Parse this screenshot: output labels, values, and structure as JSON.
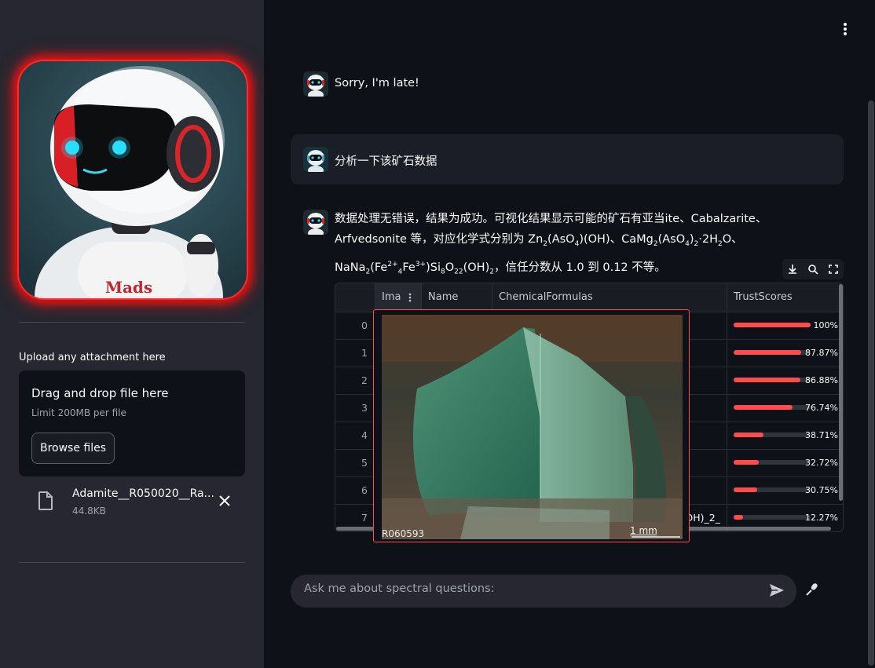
{
  "sidebar": {
    "avatar_brand": "Mads",
    "upload_label": "Upload any attachment here",
    "dropzone": {
      "title": "Drag and drop file here",
      "limit": "Limit 200MB per file",
      "browse_label": "Browse files"
    },
    "file": {
      "name": "Adamite__R050020__Ra...",
      "size": "44.8KB"
    }
  },
  "chat": {
    "messages": [
      {
        "role": "assistant",
        "text": "Sorry, I'm late!"
      },
      {
        "role": "user",
        "text": "分析一下该矿石数据"
      }
    ],
    "result": {
      "line1": "数据处理无错误，结果为成功。可视化结果显示可能的矿石有亚当ite、Cabalzarite、",
      "line2_a": "Arfvedsonite 等，对应化学式分别为 Zn",
      "line2_sub1": "2",
      "line2_b": "(AsO",
      "line2_sub2": "4",
      "line2_c": ")(OH)、CaMg",
      "line2_sub3": "2",
      "line2_d": "(AsO",
      "line2_sub4": "4",
      "line2_e": ")",
      "line2_sub5": "2",
      "line2_f": "·2H",
      "line2_sub6": "2",
      "line2_g": "O、",
      "line3_a": "NaNa",
      "line3_sub1": "2",
      "line3_b": "(Fe",
      "line3_sup1": "2+",
      "line3_sub2": "4",
      "line3_c": "Fe",
      "line3_sup2": "3+",
      "line3_d": ")Si",
      "line3_sub3": "8",
      "line3_e": "O",
      "line3_sub4": "22",
      "line3_f": "(OH)",
      "line3_sub5": "2",
      "line3_g": "，信任分数从 1.0 到 0.12 不等。"
    },
    "input_placeholder": "Ask me about spectral questions:"
  },
  "dataframe": {
    "columns": [
      "Ima",
      "Name",
      "ChemicalFormulas",
      "TrustScores"
    ],
    "rows": [
      {
        "index": "0",
        "chem": "",
        "score": 1.0,
        "score_label": "100%"
      },
      {
        "index": "1",
        "chem": "",
        "score": 0.8787,
        "score_label": "87.87%"
      },
      {
        "index": "2",
        "chem": "",
        "score": 0.8688,
        "score_label": "86.88%"
      },
      {
        "index": "3",
        "chem": "",
        "score": 0.7674,
        "score_label": "76.74%"
      },
      {
        "index": "4",
        "chem": "",
        "score": 0.3871,
        "score_label": "38.71%"
      },
      {
        "index": "5",
        "chem": "",
        "score": 0.3272,
        "score_label": "32.72%"
      },
      {
        "index": "6",
        "chem": "",
        "score": 0.3075,
        "score_label": "30.75%"
      },
      {
        "index": "7",
        "chem": "OH)_2_",
        "score": 0.1227,
        "score_label": "12.27%"
      }
    ]
  },
  "image_preview": {
    "sample_id": "R060593",
    "scale_label": "1 mm"
  },
  "colors": {
    "accent": "#ff4b4b",
    "background": "#0e1117",
    "sidebar": "#262730"
  }
}
